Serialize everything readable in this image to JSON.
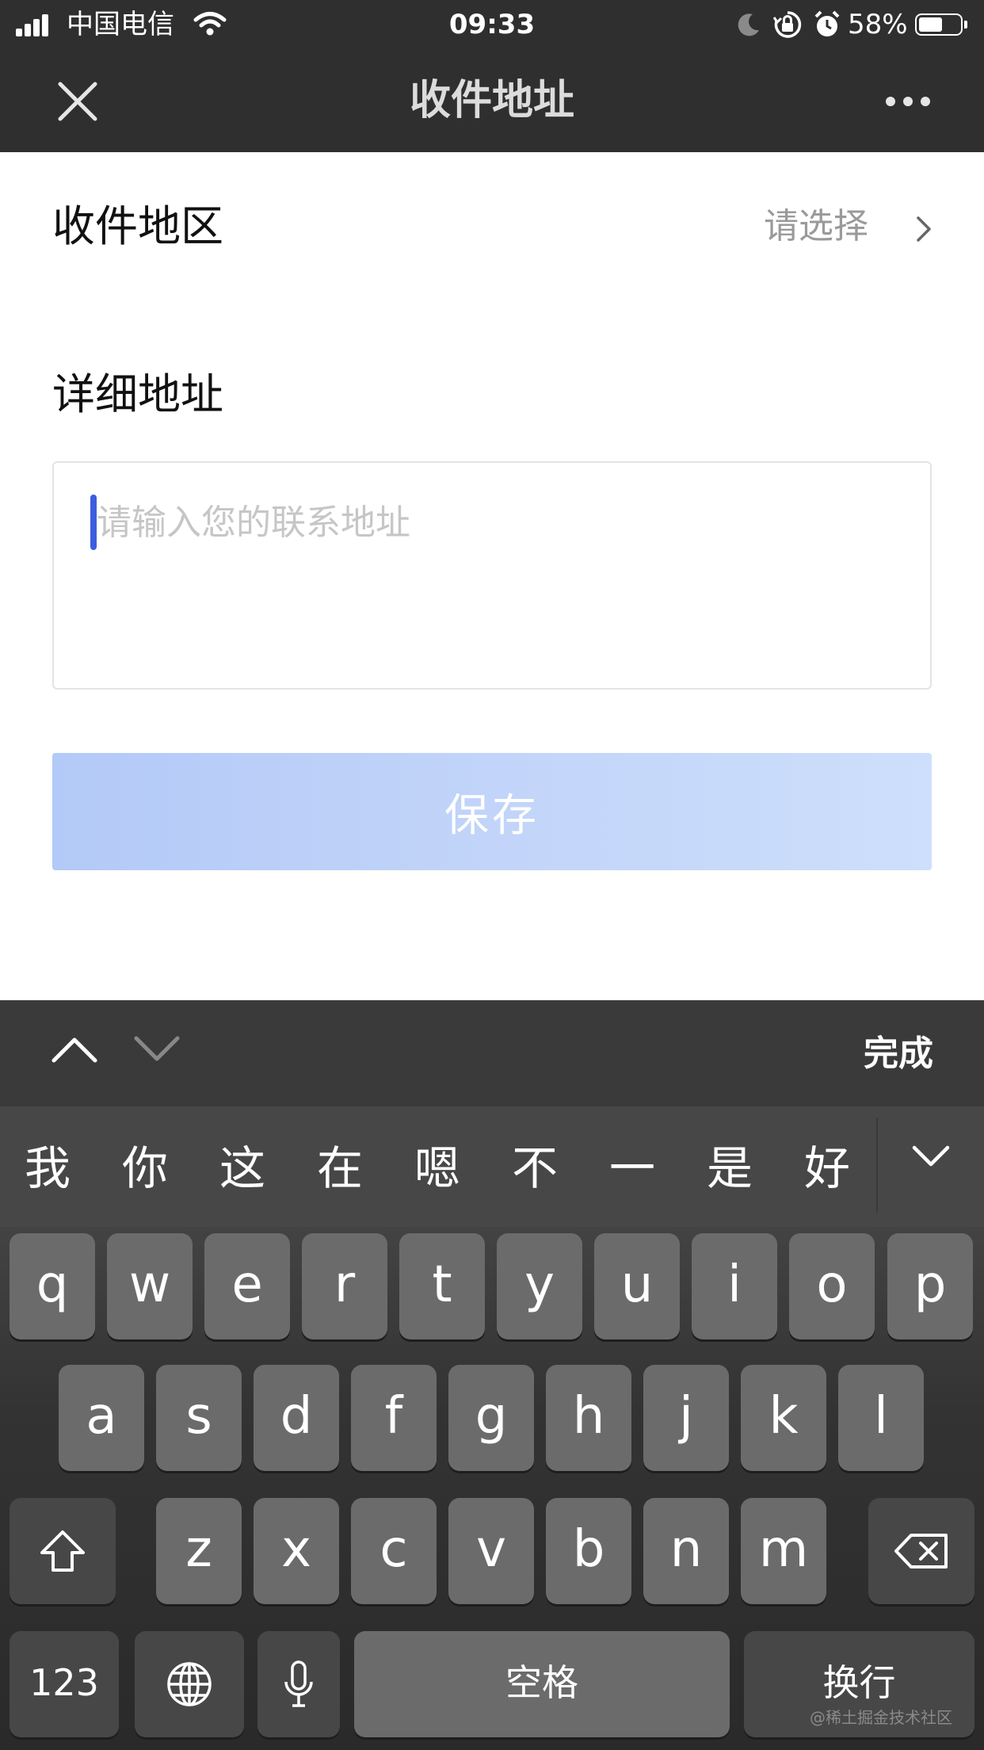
{
  "status_bar": {
    "carrier": "中国电信",
    "time": "09:33",
    "battery_percent": "58%",
    "battery_level": 0.58,
    "icons": [
      "signal-icon",
      "wifi-icon",
      "moon-icon",
      "orientation-lock-icon",
      "alarm-icon",
      "battery-icon"
    ]
  },
  "nav": {
    "title": "收件地址",
    "close_icon": "close-icon",
    "more_icon": "more-icon"
  },
  "form": {
    "region_label": "收件地区",
    "region_value": "请选择",
    "detail_label": "详细地址",
    "detail_placeholder": "请输入您的联系地址",
    "save_label": "保存",
    "save_button_color": "#c3d5f9"
  },
  "keyboard": {
    "done_label": "完成",
    "candidates": [
      "我",
      "你",
      "这",
      "在",
      "嗯",
      "不",
      "一",
      "是",
      "好"
    ],
    "row1": [
      "q",
      "w",
      "e",
      "r",
      "t",
      "y",
      "u",
      "i",
      "o",
      "p"
    ],
    "row2": [
      "a",
      "s",
      "d",
      "f",
      "g",
      "h",
      "j",
      "k",
      "l"
    ],
    "row3": [
      "z",
      "x",
      "c",
      "v",
      "b",
      "n",
      "m"
    ],
    "numbers_label": "123",
    "space_label": "空格",
    "return_label": "换行"
  },
  "watermark": "@稀土掘金技术社区"
}
